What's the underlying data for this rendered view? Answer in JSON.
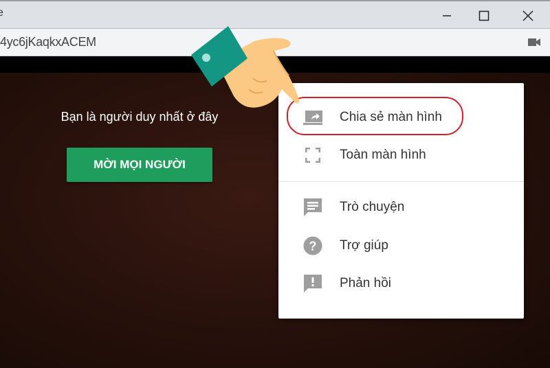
{
  "window": {
    "title_fragment": "e",
    "controls": {
      "minimize": "minimize-icon",
      "maximize": "maximize-icon",
      "close": "close-icon"
    }
  },
  "address_bar": {
    "url": "4yc6jKaqkxACEM",
    "camera_icon": "video-camera-icon"
  },
  "main": {
    "message": "Bạn là người duy nhất ở đây",
    "invite_button": "MỜI MỌI NGƯỜI"
  },
  "menu": {
    "items": [
      {
        "label": "Chia sẻ màn hình",
        "icon": "present-screen-icon",
        "highlighted": true
      },
      {
        "label": "Toàn màn hình",
        "icon": "fullscreen-icon"
      },
      {
        "label": "Trò chuyện",
        "icon": "chat-icon"
      },
      {
        "label": "Trợ giúp",
        "icon": "help-icon"
      },
      {
        "label": "Phản hồi",
        "icon": "feedback-icon"
      }
    ]
  },
  "colors": {
    "accent_green": "#1f9d5d",
    "highlight_red": "#d0202a",
    "cuff": "#139683",
    "hand": "#fcc984"
  }
}
